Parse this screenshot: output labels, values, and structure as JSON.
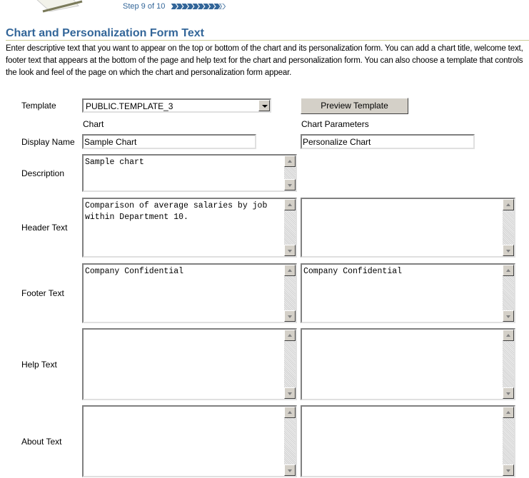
{
  "header": {
    "step_text": "Step 9 of 10",
    "progress": {
      "current_step": 9,
      "total_steps": 10
    },
    "title": "Chart and Personalization Form Text",
    "instructions": "Enter descriptive text that you want to appear on the top or bottom of the chart and its personalization form. You can add a chart title, welcome text, footer text that appears at the bottom of the page and help text for the chart and personalization form. You can also choose a template that controls the look and feel of the page on which the chart and personalization form appear."
  },
  "form": {
    "template": {
      "label": "Template",
      "selected": "PUBLIC.TEMPLATE_3"
    },
    "preview_button": "Preview Template",
    "columns": {
      "chart": "Chart",
      "parameters": "Chart Parameters"
    },
    "display_name": {
      "label": "Display Name",
      "chart": "Sample Chart",
      "parameters": "Personalize Chart"
    },
    "description": {
      "label": "Description",
      "chart": "Sample chart"
    },
    "header_text": {
      "label": "Header Text",
      "chart": "Comparison of average salaries by job within Department 10.",
      "parameters": ""
    },
    "footer_text": {
      "label": "Footer Text",
      "chart": "Company Confidential",
      "parameters": "Company Confidential"
    },
    "help_text": {
      "label": "Help Text",
      "chart": "",
      "parameters": ""
    },
    "about_text": {
      "label": "About Text",
      "chart": "",
      "parameters": ""
    }
  },
  "colors": {
    "heading": "#336699",
    "rule": "#cccc99",
    "button_face": "#d4d0c8"
  }
}
